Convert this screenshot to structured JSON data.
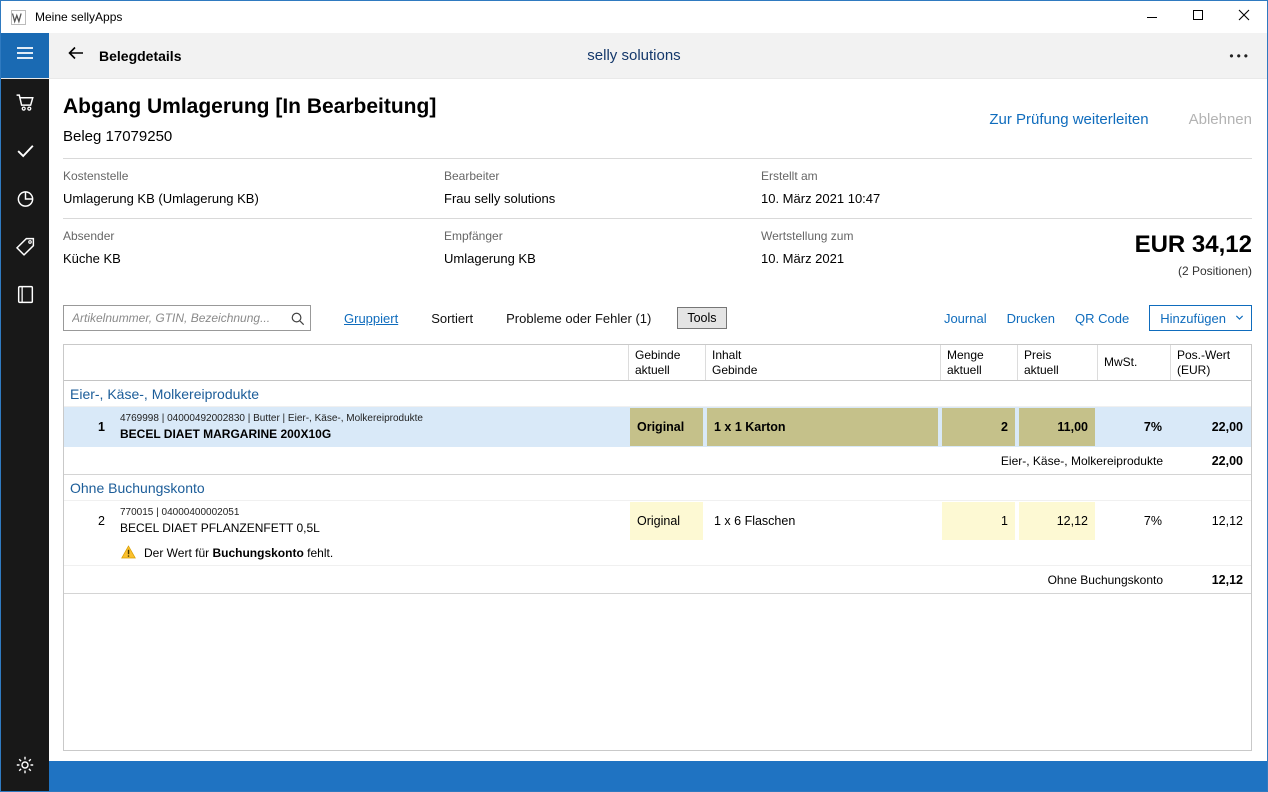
{
  "colors": {
    "accent": "#0f6cbd",
    "brand_dark_blue": "#14386b",
    "menu_button_bg": "#1a6ab3",
    "bottom_bar": "#1f73c2",
    "sidebar_bg": "#181818",
    "selected_row": "#d9e9f8",
    "editable_cell_selected": "#c5c18a",
    "editable_cell": "#fdf9d3",
    "group_title": "#1c5d99",
    "header_bg": "#f2f2f2"
  },
  "icons": [
    "app-icon",
    "minimize-icon",
    "maximize-icon",
    "close-icon",
    "menu-icon",
    "back-icon",
    "more-icon",
    "cart-icon",
    "check-icon",
    "pie-chart-icon",
    "tag-icon",
    "book-icon",
    "gear-icon",
    "search-icon",
    "warning-icon",
    "chevron-down-icon"
  ],
  "titlebar": {
    "title": "Meine sellyApps"
  },
  "header": {
    "title": "Belegdetails",
    "center": "selly solutions",
    "more": "•••"
  },
  "doc": {
    "title": "Abgang Umlagerung [In Bearbeitung]",
    "subtitle": "Beleg 17079250",
    "action_forward": "Zur Prüfung weiterleiten",
    "action_reject": "Ablehnen",
    "fields": [
      {
        "label": "Kostenstelle",
        "value": "Umlagerung KB (Umlagerung KB)"
      },
      {
        "label": "Bearbeiter",
        "value": "Frau selly solutions"
      },
      {
        "label": "Erstellt am",
        "value": "10. März 2021 10:47"
      },
      {
        "label": "Absender",
        "value": "Küche KB"
      },
      {
        "label": "Empfänger",
        "value": "Umlagerung KB"
      },
      {
        "label": "Wertstellung zum",
        "value": "10. März 2021"
      }
    ],
    "total_amount": "EUR 34,12",
    "total_positions": "(2 Positionen)"
  },
  "toolbar": {
    "search_placeholder": "Artikelnummer, GTIN, Bezeichnung...",
    "grouped": "Gruppiert",
    "sorted": "Sortiert",
    "problems": "Probleme oder Fehler (1)",
    "tools": "Tools",
    "journal": "Journal",
    "print": "Drucken",
    "qr_code": "QR Code",
    "add": "Hinzufügen"
  },
  "table": {
    "headers": {
      "gebinde": [
        "Gebinde",
        "aktuell"
      ],
      "inhalt": [
        "Inhalt",
        "Gebinde"
      ],
      "menge": [
        "Menge",
        "aktuell"
      ],
      "preis": [
        "Preis",
        "aktuell"
      ],
      "mwst": "MwSt.",
      "wert": [
        "Pos.-Wert",
        "(EUR)"
      ]
    },
    "groups": [
      {
        "title": "Eier-, Käse-, Molkereiprodukte",
        "subtotal_label": "Eier-, Käse-, Molkereiprodukte",
        "subtotal_value": "22,00",
        "rows": [
          {
            "pos": "1",
            "meta": "4769998 | 04000492002830 | Butter | Eier-, Käse-, Molkereiprodukte",
            "name": "BECEL DIAET MARGARINE 200X10G",
            "gebinde": "Original",
            "inhalt": "1 x 1 Karton",
            "menge": "2",
            "preis": "11,00",
            "mwst": "7%",
            "wert": "22,00"
          }
        ]
      },
      {
        "title": "Ohne Buchungskonto",
        "subtotal_label": "Ohne Buchungskonto",
        "subtotal_value": "12,12",
        "rows": [
          {
            "pos": "2",
            "meta": "770015 | 04000400002051",
            "name": "BECEL DIAET PFLANZENFETT 0,5L",
            "gebinde": "Original",
            "inhalt": "1 x 6 Flaschen",
            "menge": "1",
            "preis": "12,12",
            "mwst": "7%",
            "wert": "12,12",
            "warning_pre": "Der Wert für ",
            "warning_bold": "Buchungskonto",
            "warning_post": " fehlt."
          }
        ]
      }
    ]
  }
}
